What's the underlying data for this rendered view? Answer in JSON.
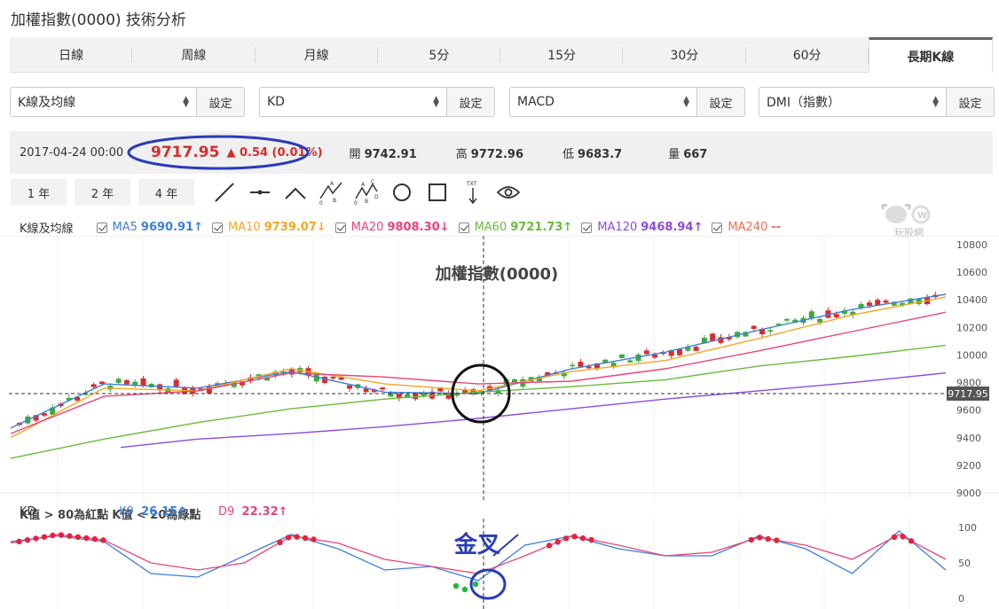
{
  "page": {
    "title": "加權指數(0000) 技術分析"
  },
  "tabs": [
    "日線",
    "周線",
    "月線",
    "5分",
    "15分",
    "30分",
    "60分",
    "長期K線"
  ],
  "active_tab": 7,
  "selectors": [
    {
      "value": "K線及均線",
      "button": "設定"
    },
    {
      "value": "KD",
      "button": "設定"
    },
    {
      "value": "MACD",
      "button": "設定"
    },
    {
      "value": "DMI（指數）",
      "button": "設定"
    }
  ],
  "info": {
    "date": "2017-04-24 00:00",
    "price": "9717.95",
    "change": "▲ 0.54 (0.01%)",
    "open_label": "開",
    "open": "9742.91",
    "high_label": "高",
    "high": "9772.96",
    "low_label": "低",
    "low": "9683.7",
    "vol_label": "量",
    "vol": "667"
  },
  "range_buttons": [
    "1 年",
    "2 年",
    "4 年"
  ],
  "drawing_tools": [
    "line-tool-icon",
    "segment-tool-icon",
    "angle-tool-icon",
    "abc-pattern-icon",
    "abcd-pattern-icon",
    "circle-tool-icon",
    "rect-tool-icon",
    "text-tool-icon",
    "eye-icon"
  ],
  "ma_legend": {
    "label": "K線及均線",
    "items": [
      {
        "name": "MA5",
        "value": "9690.91↑",
        "color": "#3e7fd8"
      },
      {
        "name": "MA10",
        "value": "9739.07↓",
        "color": "#f5a623"
      },
      {
        "name": "MA20",
        "value": "9808.30↓",
        "color": "#e6457a"
      },
      {
        "name": "MA60",
        "value": "9721.73↑",
        "color": "#6aba3d"
      },
      {
        "name": "MA120",
        "value": "9468.94↑",
        "color": "#8c4be0"
      },
      {
        "name": "MA240",
        "value": "--",
        "color": "#f26c4f"
      }
    ]
  },
  "watermark": "玩股網",
  "chart": {
    "title": "加權指數(0000)",
    "y_ticks": [
      "10800",
      "10600",
      "10400",
      "10200",
      "10000",
      "9800",
      "9600",
      "9400",
      "9200",
      "9000"
    ],
    "current_label": "9717.95",
    "annotation": "金叉"
  },
  "kd_legend": {
    "label": "KD",
    "k_name": "K9",
    "k_value": "26.15↑",
    "d_name": "D9",
    "d_value": "22.32↑",
    "note1": "K值 > 80為紅點",
    "note2": "K值 < 20為綠點",
    "y_ticks": [
      "100",
      "50",
      "0"
    ]
  },
  "colors": {
    "up": "#d62d2d",
    "down": "#3daa3d",
    "annotation": "#2a3cb8"
  },
  "chart_data": [
    {
      "type": "line",
      "title": "加權指數(0000)",
      "ylim": [
        9000,
        10800
      ],
      "series": [
        {
          "name": "MA5",
          "x": [
            0,
            10,
            20,
            30,
            40,
            50,
            60,
            70,
            80,
            90,
            100
          ],
          "y": [
            9470,
            9790,
            9760,
            9880,
            9730,
            9720,
            9900,
            10020,
            10180,
            10330,
            10440
          ]
        },
        {
          "name": "MA10",
          "x": [
            0,
            10,
            20,
            30,
            40,
            50,
            60,
            70,
            80,
            90,
            100
          ],
          "y": [
            9400,
            9760,
            9740,
            9900,
            9790,
            9740,
            9880,
            9960,
            10120,
            10290,
            10420
          ]
        },
        {
          "name": "MA20",
          "x": [
            0,
            10,
            20,
            30,
            40,
            50,
            60,
            70,
            80,
            90,
            100
          ],
          "y": [
            9430,
            9700,
            9740,
            9870,
            9840,
            9790,
            9810,
            9900,
            10030,
            10170,
            10310
          ]
        },
        {
          "name": "MA60",
          "x": [
            0,
            10,
            20,
            30,
            40,
            50,
            60,
            70,
            80,
            90,
            100
          ],
          "y": [
            9250,
            9390,
            9510,
            9610,
            9680,
            9730,
            9770,
            9820,
            9920,
            9990,
            10070
          ]
        },
        {
          "name": "MA120",
          "x": [
            0,
            10,
            20,
            30,
            40,
            50,
            60,
            70,
            80,
            90,
            100
          ],
          "y": [
            9270,
            9330,
            9390,
            9430,
            9480,
            9540,
            9610,
            9680,
            9740,
            9800,
            9870
          ]
        }
      ]
    },
    {
      "type": "line",
      "title": "KD",
      "ylim": [
        0,
        100
      ],
      "series": [
        {
          "name": "K9",
          "x": [
            0,
            5,
            10,
            15,
            20,
            25,
            30,
            35,
            40,
            45,
            50,
            55,
            60,
            65,
            70,
            75,
            80,
            85,
            90,
            95,
            100
          ],
          "y": [
            80,
            88,
            80,
            35,
            30,
            60,
            90,
            70,
            40,
            45,
            25,
            75,
            88,
            70,
            60,
            60,
            88,
            70,
            35,
            95,
            40
          ]
        },
        {
          "name": "D9",
          "x": [
            0,
            5,
            10,
            15,
            20,
            25,
            30,
            35,
            40,
            45,
            50,
            55,
            60,
            65,
            70,
            75,
            80,
            85,
            90,
            95,
            100
          ],
          "y": [
            78,
            90,
            82,
            50,
            40,
            50,
            88,
            78,
            55,
            45,
            35,
            60,
            88,
            75,
            60,
            65,
            86,
            75,
            55,
            90,
            55
          ]
        }
      ]
    }
  ]
}
